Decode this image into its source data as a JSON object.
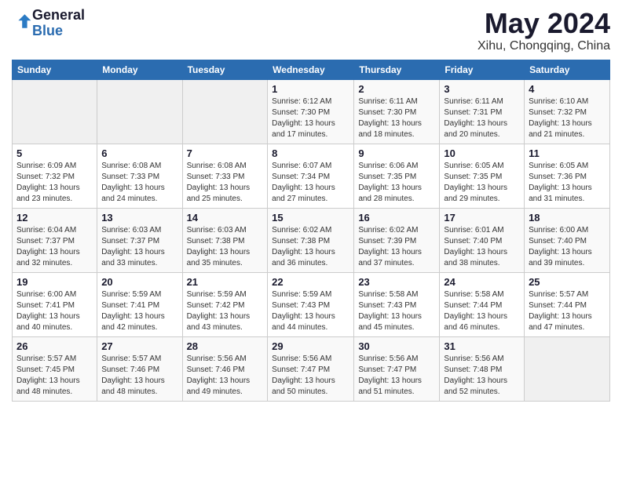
{
  "logo": {
    "line1": "General",
    "line2": "Blue"
  },
  "title": "May 2024",
  "subtitle": "Xihu, Chongqing, China",
  "days_header": [
    "Sunday",
    "Monday",
    "Tuesday",
    "Wednesday",
    "Thursday",
    "Friday",
    "Saturday"
  ],
  "weeks": [
    [
      {
        "num": "",
        "info": ""
      },
      {
        "num": "",
        "info": ""
      },
      {
        "num": "",
        "info": ""
      },
      {
        "num": "1",
        "info": "Sunrise: 6:12 AM\nSunset: 7:30 PM\nDaylight: 13 hours and 17 minutes."
      },
      {
        "num": "2",
        "info": "Sunrise: 6:11 AM\nSunset: 7:30 PM\nDaylight: 13 hours and 18 minutes."
      },
      {
        "num": "3",
        "info": "Sunrise: 6:11 AM\nSunset: 7:31 PM\nDaylight: 13 hours and 20 minutes."
      },
      {
        "num": "4",
        "info": "Sunrise: 6:10 AM\nSunset: 7:32 PM\nDaylight: 13 hours and 21 minutes."
      }
    ],
    [
      {
        "num": "5",
        "info": "Sunrise: 6:09 AM\nSunset: 7:32 PM\nDaylight: 13 hours and 23 minutes."
      },
      {
        "num": "6",
        "info": "Sunrise: 6:08 AM\nSunset: 7:33 PM\nDaylight: 13 hours and 24 minutes."
      },
      {
        "num": "7",
        "info": "Sunrise: 6:08 AM\nSunset: 7:33 PM\nDaylight: 13 hours and 25 minutes."
      },
      {
        "num": "8",
        "info": "Sunrise: 6:07 AM\nSunset: 7:34 PM\nDaylight: 13 hours and 27 minutes."
      },
      {
        "num": "9",
        "info": "Sunrise: 6:06 AM\nSunset: 7:35 PM\nDaylight: 13 hours and 28 minutes."
      },
      {
        "num": "10",
        "info": "Sunrise: 6:05 AM\nSunset: 7:35 PM\nDaylight: 13 hours and 29 minutes."
      },
      {
        "num": "11",
        "info": "Sunrise: 6:05 AM\nSunset: 7:36 PM\nDaylight: 13 hours and 31 minutes."
      }
    ],
    [
      {
        "num": "12",
        "info": "Sunrise: 6:04 AM\nSunset: 7:37 PM\nDaylight: 13 hours and 32 minutes."
      },
      {
        "num": "13",
        "info": "Sunrise: 6:03 AM\nSunset: 7:37 PM\nDaylight: 13 hours and 33 minutes."
      },
      {
        "num": "14",
        "info": "Sunrise: 6:03 AM\nSunset: 7:38 PM\nDaylight: 13 hours and 35 minutes."
      },
      {
        "num": "15",
        "info": "Sunrise: 6:02 AM\nSunset: 7:38 PM\nDaylight: 13 hours and 36 minutes."
      },
      {
        "num": "16",
        "info": "Sunrise: 6:02 AM\nSunset: 7:39 PM\nDaylight: 13 hours and 37 minutes."
      },
      {
        "num": "17",
        "info": "Sunrise: 6:01 AM\nSunset: 7:40 PM\nDaylight: 13 hours and 38 minutes."
      },
      {
        "num": "18",
        "info": "Sunrise: 6:00 AM\nSunset: 7:40 PM\nDaylight: 13 hours and 39 minutes."
      }
    ],
    [
      {
        "num": "19",
        "info": "Sunrise: 6:00 AM\nSunset: 7:41 PM\nDaylight: 13 hours and 40 minutes."
      },
      {
        "num": "20",
        "info": "Sunrise: 5:59 AM\nSunset: 7:41 PM\nDaylight: 13 hours and 42 minutes."
      },
      {
        "num": "21",
        "info": "Sunrise: 5:59 AM\nSunset: 7:42 PM\nDaylight: 13 hours and 43 minutes."
      },
      {
        "num": "22",
        "info": "Sunrise: 5:59 AM\nSunset: 7:43 PM\nDaylight: 13 hours and 44 minutes."
      },
      {
        "num": "23",
        "info": "Sunrise: 5:58 AM\nSunset: 7:43 PM\nDaylight: 13 hours and 45 minutes."
      },
      {
        "num": "24",
        "info": "Sunrise: 5:58 AM\nSunset: 7:44 PM\nDaylight: 13 hours and 46 minutes."
      },
      {
        "num": "25",
        "info": "Sunrise: 5:57 AM\nSunset: 7:44 PM\nDaylight: 13 hours and 47 minutes."
      }
    ],
    [
      {
        "num": "26",
        "info": "Sunrise: 5:57 AM\nSunset: 7:45 PM\nDaylight: 13 hours and 48 minutes."
      },
      {
        "num": "27",
        "info": "Sunrise: 5:57 AM\nSunset: 7:46 PM\nDaylight: 13 hours and 48 minutes."
      },
      {
        "num": "28",
        "info": "Sunrise: 5:56 AM\nSunset: 7:46 PM\nDaylight: 13 hours and 49 minutes."
      },
      {
        "num": "29",
        "info": "Sunrise: 5:56 AM\nSunset: 7:47 PM\nDaylight: 13 hours and 50 minutes."
      },
      {
        "num": "30",
        "info": "Sunrise: 5:56 AM\nSunset: 7:47 PM\nDaylight: 13 hours and 51 minutes."
      },
      {
        "num": "31",
        "info": "Sunrise: 5:56 AM\nSunset: 7:48 PM\nDaylight: 13 hours and 52 minutes."
      },
      {
        "num": "",
        "info": ""
      }
    ]
  ]
}
